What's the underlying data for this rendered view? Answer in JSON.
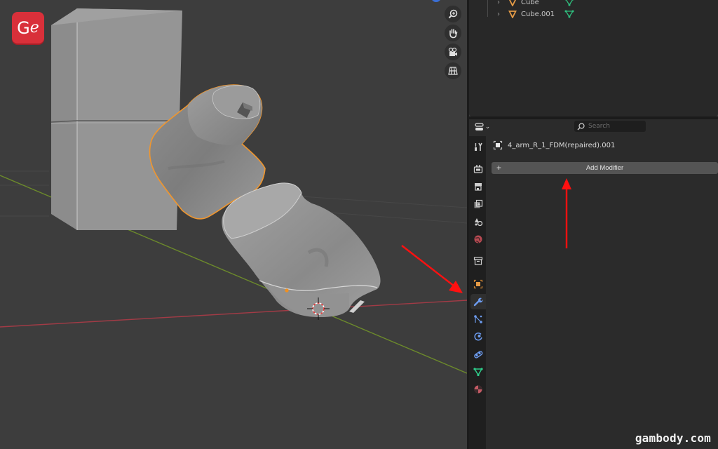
{
  "logo": {
    "text_main": "G",
    "text_accent": "e",
    "color": "#d9303a"
  },
  "viewport": {
    "gizmos": [
      {
        "name": "zoom-icon"
      },
      {
        "name": "hand-pan-icon"
      },
      {
        "name": "camera-view-icon"
      },
      {
        "name": "grid-perspective-icon"
      }
    ],
    "axis_colors": {
      "x": "#a23b46",
      "y": "#6c8a2b"
    },
    "selection_outline_color": "#f0962e"
  },
  "outliner": {
    "items": [
      {
        "name": "Cube",
        "type_icon": "mesh-object-icon",
        "data_icon": "mesh-data-icon"
      },
      {
        "name": "Cube.001",
        "type_icon": "mesh-object-icon",
        "data_icon": "mesh-data-icon"
      }
    ]
  },
  "properties": {
    "search_placeholder": "Search",
    "object_name": "4_arm_R_1_FDM(repaired).001",
    "add_modifier_label": "Add Modifier",
    "add_modifier_plus": "+",
    "tabs": [
      {
        "name": "tool-icon",
        "color": "#d0d0d0",
        "active": false
      },
      {
        "name": "render-icon",
        "color": "#d0d0d0",
        "active": false
      },
      {
        "name": "output-icon",
        "color": "#d0d0d0",
        "active": false
      },
      {
        "name": "view-layer-icon",
        "color": "#d0d0d0",
        "active": false
      },
      {
        "name": "scene-icon",
        "color": "#d0d0d0",
        "active": false
      },
      {
        "name": "world-icon",
        "color": "#c4545c",
        "active": false
      },
      {
        "name": "collection-icon",
        "color": "#d0d0d0",
        "active": false
      },
      {
        "name": "object-icon",
        "color": "#e39a46",
        "active": false
      },
      {
        "name": "modifier-wrench-icon",
        "color": "#6d9cf0",
        "active": true
      },
      {
        "name": "particles-icon",
        "color": "#6d9cf0",
        "active": false
      },
      {
        "name": "physics-icon",
        "color": "#6d9cf0",
        "active": false
      },
      {
        "name": "constraints-icon",
        "color": "#6d9cf0",
        "active": false
      },
      {
        "name": "object-data-icon",
        "color": "#2fcc8a",
        "active": false
      },
      {
        "name": "material-icon",
        "color": "#d06670",
        "active": false
      }
    ]
  },
  "watermark": "gambody.com",
  "annotation_color": "#ff1010"
}
